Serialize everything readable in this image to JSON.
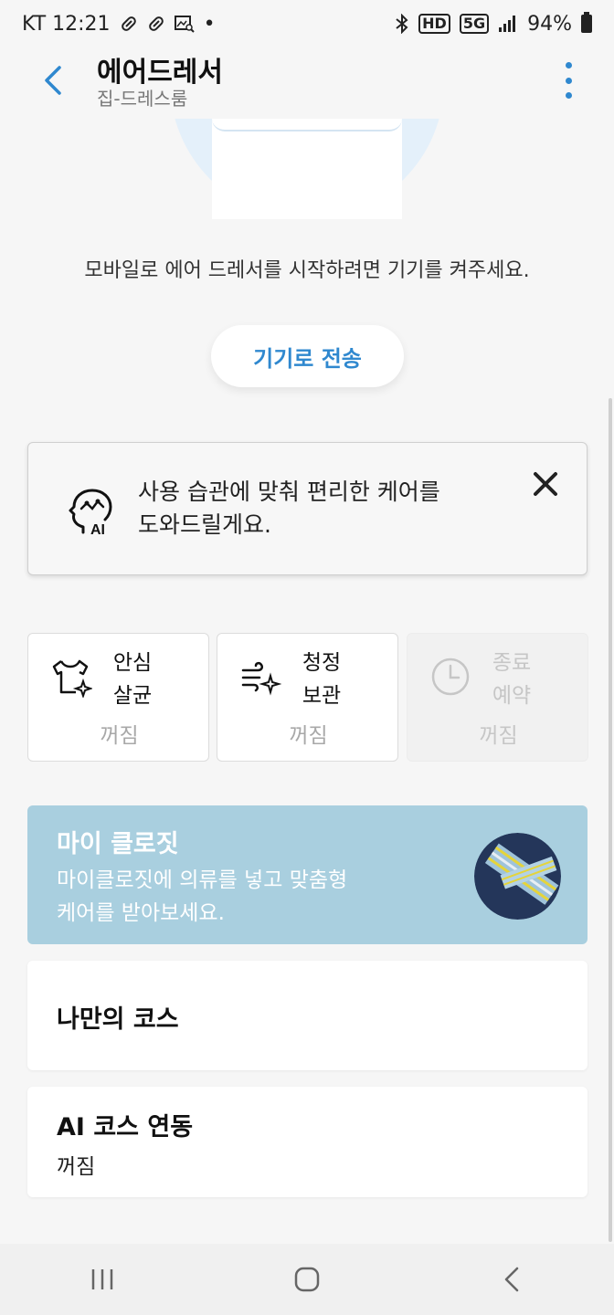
{
  "status_bar": {
    "carrier_time": "KT 12:21",
    "dot": "•",
    "hd": "HD",
    "network": "5G",
    "battery": "94%"
  },
  "header": {
    "title": "에어드레서",
    "subtitle": "집-드레스룸"
  },
  "hint": "모바일로 에어 드레서를 시작하려면 기기를 켜주세요.",
  "send_button": "기기로 전송",
  "ai_card": {
    "line1": "사용 습관에 맞춰 편리한 케어를",
    "line2": "도와드릴게요."
  },
  "tiles": [
    {
      "line1": "안심",
      "line2": "살균",
      "state": "꺼짐",
      "icon": "shirt-sparkle-icon",
      "enabled": true
    },
    {
      "line1": "청정",
      "line2": "보관",
      "state": "꺼짐",
      "icon": "wind-sparkle-icon",
      "enabled": true
    },
    {
      "line1": "종료",
      "line2": "예약",
      "state": "꺼짐",
      "icon": "clock-icon",
      "enabled": false
    }
  ],
  "closet": {
    "title": "마이 클로짓",
    "desc_line1": "마이클로짓에 의류를 넣고 맞춤형",
    "desc_line2": "케어를 받아보세요."
  },
  "my_course": {
    "title": "나만의 코스"
  },
  "ai_course": {
    "title": "AI 코스 연동",
    "state": "꺼짐"
  },
  "colors": {
    "accent": "#2f88cf",
    "closet_bg": "#a9cfdf",
    "background": "#f6f6f6"
  }
}
